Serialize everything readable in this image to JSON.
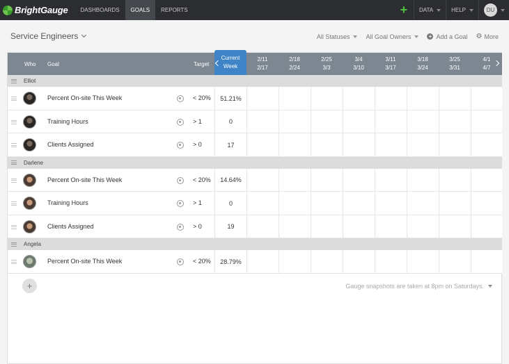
{
  "nav": {
    "logo": "BrightGauge",
    "links": [
      "DASHBOARDS",
      "GOALS",
      "REPORTS"
    ],
    "active": "GOALS",
    "data_label": "DATA",
    "help_label": "HELP",
    "user_initials": "DU",
    "add_icon": "plus"
  },
  "header": {
    "title": "Service Engineers",
    "statuses": "All Statuses",
    "owners": "All Goal Owners",
    "add_goal": "Add a Goal",
    "more": "More"
  },
  "table": {
    "col_who": "Who",
    "col_goal": "Goal",
    "col_target": "Target",
    "current_line1": "Current",
    "current_line2": "Week",
    "weeks": [
      {
        "top": "2/11",
        "bottom": "2/17"
      },
      {
        "top": "2/18",
        "bottom": "2/24"
      },
      {
        "top": "2/25",
        "bottom": "3/3"
      },
      {
        "top": "3/4",
        "bottom": "3/10"
      },
      {
        "top": "3/11",
        "bottom": "3/17"
      },
      {
        "top": "3/18",
        "bottom": "3/24"
      },
      {
        "top": "3/25",
        "bottom": "3/31"
      },
      {
        "top": "4/1",
        "bottom": "4/7"
      }
    ],
    "groups": [
      {
        "name": "Elliot",
        "goals": [
          {
            "goal": "Percent On-site This Week",
            "target": "< 20%",
            "current": "51.21%"
          },
          {
            "goal": "Training Hours",
            "target": "> 1",
            "current": "0"
          },
          {
            "goal": "Clients Assigned",
            "target": "> 0",
            "current": "17"
          }
        ]
      },
      {
        "name": "Darlene",
        "goals": [
          {
            "goal": "Percent On-site This Week",
            "target": "< 20%",
            "current": "14.64%"
          },
          {
            "goal": "Training Hours",
            "target": "> 1",
            "current": "0"
          },
          {
            "goal": "Clients Assigned",
            "target": "> 0",
            "current": "19"
          }
        ]
      },
      {
        "name": "Angela",
        "goals": [
          {
            "goal": "Percent On-site This Week",
            "target": "< 20%",
            "current": "28.79%"
          }
        ]
      }
    ]
  },
  "footer": {
    "snapshot_note": "Gauge snapshots are taken at 8pm on Saturdays.",
    "add_icon": "plus"
  }
}
